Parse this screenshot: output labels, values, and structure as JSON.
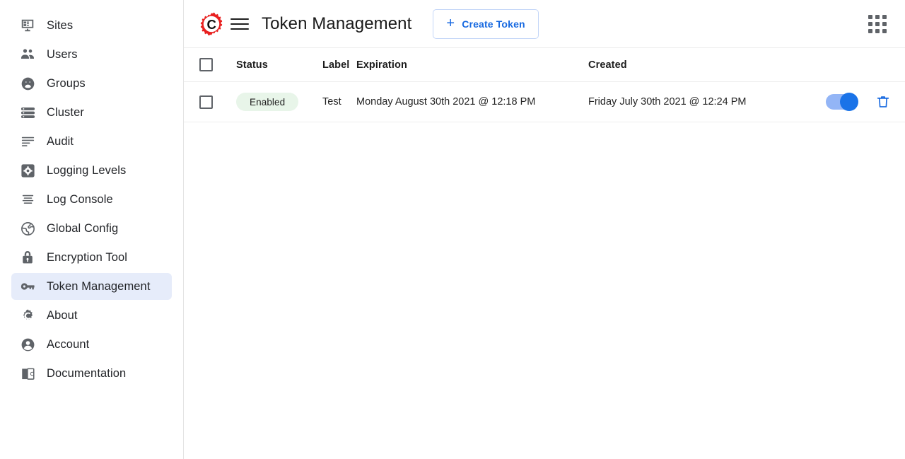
{
  "sidebar": {
    "items": [
      {
        "label": "Sites",
        "icon": "sites-icon",
        "active": false
      },
      {
        "label": "Users",
        "icon": "users-icon",
        "active": false
      },
      {
        "label": "Groups",
        "icon": "groups-icon",
        "active": false
      },
      {
        "label": "Cluster",
        "icon": "cluster-icon",
        "active": false
      },
      {
        "label": "Audit",
        "icon": "audit-icon",
        "active": false
      },
      {
        "label": "Logging Levels",
        "icon": "logging-levels-icon",
        "active": false
      },
      {
        "label": "Log Console",
        "icon": "log-console-icon",
        "active": false
      },
      {
        "label": "Global Config",
        "icon": "global-config-icon",
        "active": false
      },
      {
        "label": "Encryption Tool",
        "icon": "encryption-tool-icon",
        "active": false
      },
      {
        "label": "Token Management",
        "icon": "token-management-icon",
        "active": true
      },
      {
        "label": "About",
        "icon": "about-icon",
        "active": false
      },
      {
        "label": "Account",
        "icon": "account-icon",
        "active": false
      },
      {
        "label": "Documentation",
        "icon": "documentation-icon",
        "active": false
      }
    ]
  },
  "header": {
    "logo_icon": "gear-c-logo-icon",
    "menu_icon": "hamburger-menu-icon",
    "title": "Token Management",
    "create_button": {
      "label": "Create Token",
      "icon": "plus-icon",
      "plus": "+"
    },
    "apps_icon": "apps-grid-icon"
  },
  "table": {
    "columns": [
      "Status",
      "Label",
      "Expiration",
      "Created"
    ],
    "select_all_checkbox": {
      "checked": false
    },
    "rows": [
      {
        "checked": false,
        "status": "Enabled",
        "label": "Test",
        "expiration": "Monday August 30th 2021 @ 12:18 PM",
        "created": "Friday July 30th 2021 @ 12:24 PM",
        "enabled_toggle": true,
        "delete_icon": "trash-icon"
      }
    ]
  },
  "colors": {
    "accent_blue": "#1769e0",
    "toggle_on": "#1a73e8",
    "toggle_track": "#93b5f6",
    "badge_bg": "#e8f5e9",
    "active_nav_bg": "#e6ecfa",
    "logo_red": "#e8201f",
    "border": "#ededed"
  }
}
